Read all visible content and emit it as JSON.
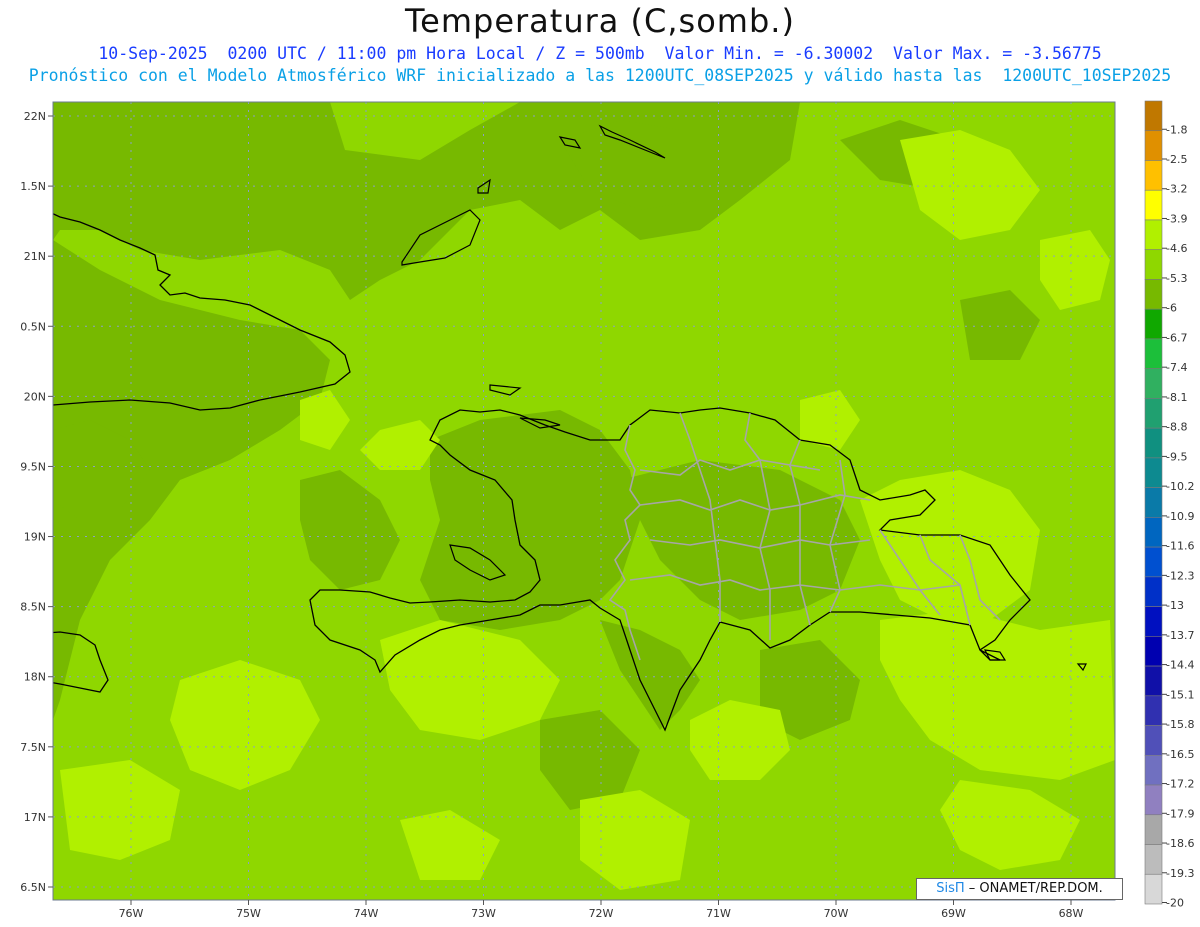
{
  "header": {
    "title": "Temperatura (C,somb.)",
    "line1": "10-Sep-2025  0200 UTC / 11:00 pm Hora Local / Z = 500mb  Valor Min. = -6.30002  Valor Max. = -3.56775",
    "line2": "Pronóstico con el Modelo Atmosférico WRF inicializado a las 1200UTC_08SEP2025 y válido hasta las  1200UTC_10SEP2025"
  },
  "map": {
    "lat_labels": [
      "22N",
      "1.5N",
      "21N",
      "0.5N",
      "20N",
      "9.5N",
      "19N",
      "8.5N",
      "18N",
      "7.5N",
      "17N",
      "6.5N"
    ],
    "lon_labels": [
      "76W",
      "75W",
      "74W",
      "73W",
      "72W",
      "71W",
      "70W",
      "69W",
      "68W"
    ],
    "colors": {
      "base": "#8fd700",
      "darker": "#77b900",
      "lighter": "#b1f000",
      "coast": "#000000",
      "borders": "#a0a0a0"
    }
  },
  "legend": {
    "labels": [
      "-1.8",
      "-2.5",
      "-3.2",
      "-3.9",
      "-4.6",
      "-5.3",
      "-6",
      "-6.7",
      "-7.4",
      "-8.1",
      "-8.8",
      "-9.5",
      "-10.2",
      "-10.9",
      "-11.6",
      "-12.3",
      "-13",
      "-13.7",
      "-14.4",
      "-15.1",
      "-15.8",
      "-16.5",
      "-17.2",
      "-17.9",
      "-18.6",
      "-19.3",
      "-20"
    ],
    "colors": [
      "#c07800",
      "#e09000",
      "#ffc000",
      "#ffff00",
      "#b1f000",
      "#8fd700",
      "#77b900",
      "#10a800",
      "#1cbf3a",
      "#30b060",
      "#20a070",
      "#109080",
      "#0d8a90",
      "#0a7aa8",
      "#0066c0",
      "#0050d0",
      "#0030c8",
      "#0010c0",
      "#0000b0",
      "#1010a8",
      "#3030b0",
      "#5050b8",
      "#7070c0",
      "#9080c0",
      "#a8a8a8",
      "#bcbcbc",
      "#d8d8d8"
    ]
  },
  "credit": {
    "brand": "SisΠ",
    "text": " – ONAMET/REP.DOM."
  }
}
